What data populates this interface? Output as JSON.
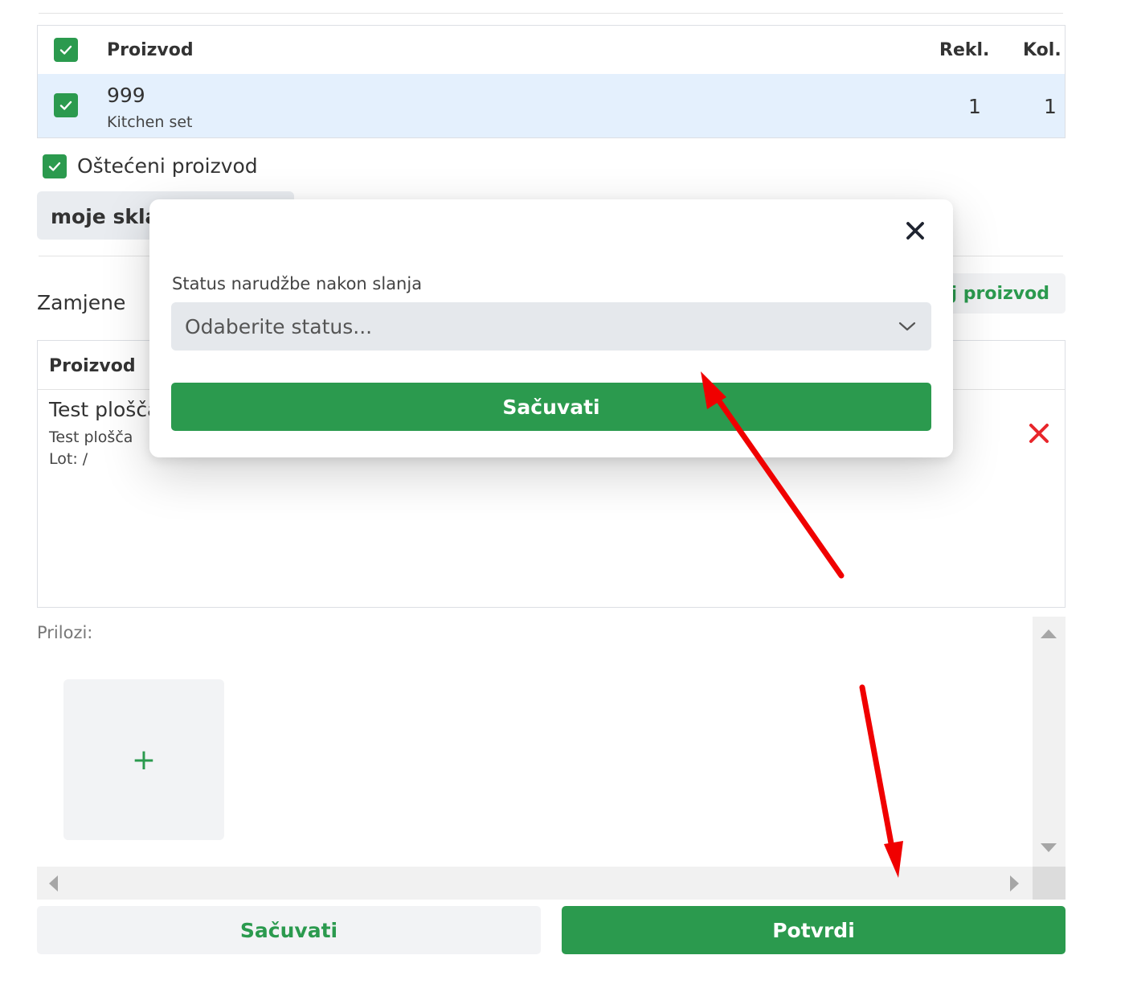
{
  "claim_table": {
    "header": {
      "product": "Proizvod",
      "rekl": "Rekl.",
      "kol": "Kol."
    },
    "rows": [
      {
        "code": "999",
        "name": "Kitchen set",
        "rekl": "1",
        "kol": "1"
      }
    ]
  },
  "damaged_label": "Oštećeni proizvod",
  "warehouse_label": "moje sklad",
  "replacements": {
    "title": "Zamjene",
    "add_button": "laj proizvod",
    "header_product": "Proizvod",
    "rows": [
      {
        "title": "Test plošča",
        "subtitle": "Test plošča",
        "lot": "Lot: /"
      }
    ]
  },
  "attachments": {
    "label": "Prilozi:",
    "add": "+"
  },
  "footer": {
    "save": "Sačuvati",
    "confirm": "Potvrdi"
  },
  "modal": {
    "close": "✕",
    "field_label": "Status narudžbe nakon slanja",
    "select_placeholder": "Odaberite status...",
    "save": "Sačuvati"
  },
  "colors": {
    "accent": "#2b9a4e",
    "selected_row": "#e4f0fd",
    "annotation": "#f00000",
    "delete": "#e8262b"
  }
}
